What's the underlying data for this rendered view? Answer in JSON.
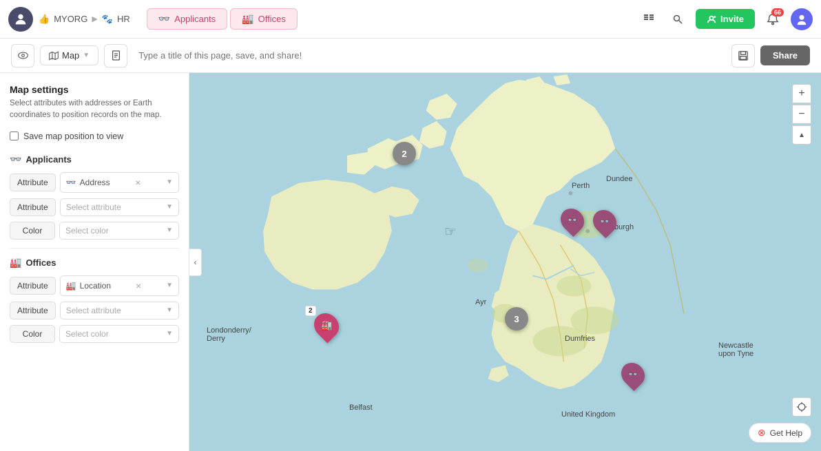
{
  "topbar": {
    "org_label": "MYORG",
    "section_label": "HR",
    "tab_applicants": "Applicants",
    "tab_offices": "Offices",
    "invite_label": "Invite",
    "notif_count": "66"
  },
  "toolbar2": {
    "map_label": "Map",
    "title_placeholder": "Type a title of this page, save, and share!",
    "share_label": "Share"
  },
  "sidebar": {
    "title": "Map settings",
    "description": "Select attributes with addresses or Earth coordinates to position records on the map.",
    "save_position_label": "Save map position to view",
    "applicants_section": "Applicants",
    "offices_section": "Offices",
    "applicants_attr1_label": "Attribute",
    "applicants_attr1_value": "Address",
    "applicants_attr2_label": "Attribute",
    "applicants_attr2_placeholder": "Select attribute",
    "applicants_color_label": "Color",
    "applicants_color_placeholder": "Select color",
    "offices_attr1_label": "Attribute",
    "offices_attr1_value": "Location",
    "offices_attr2_label": "Attribute",
    "offices_attr2_placeholder": "Select attribute",
    "offices_color_label": "Color",
    "offices_color_placeholder": "Select color"
  },
  "map": {
    "zoom_in": "+",
    "zoom_out": "−",
    "reset": "▲",
    "locate": "⊕",
    "help": "Get Help",
    "place_labels": [
      "Perth",
      "Dundee",
      "Ayr",
      "Dumfries",
      "Newcastle upon Tyne",
      "Londonderry/ Derry",
      "Belfast",
      "Edinburgh",
      "United Kingdom"
    ],
    "clusters": [
      {
        "count": "2",
        "left": "215",
        "top": "105"
      },
      {
        "count": "3",
        "left": "465",
        "top": "250"
      }
    ],
    "pins": [
      {
        "type": "offices",
        "left": "205",
        "top": "273",
        "icon": "🏭",
        "cluster_count": "2"
      },
      {
        "type": "applicants",
        "left": "548",
        "top": "198",
        "icon": "👓"
      },
      {
        "type": "applicants",
        "left": "610",
        "top": "213",
        "icon": "👓"
      },
      {
        "type": "applicants",
        "left": "640",
        "top": "440",
        "icon": "👓"
      }
    ]
  }
}
